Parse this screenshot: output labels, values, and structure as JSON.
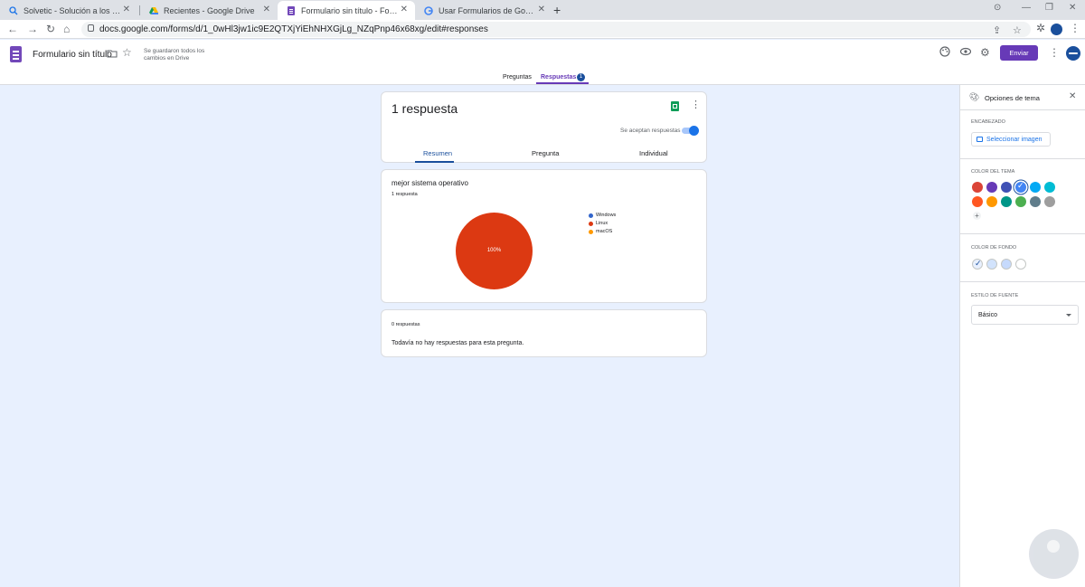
{
  "browser": {
    "tabs": [
      {
        "label": "Solvetic - Solución a los problemas",
        "icon": "search-icon"
      },
      {
        "label": "Recientes - Google Drive",
        "icon": "drive-icon"
      },
      {
        "label": "Formulario sin título - Formularios",
        "icon": "forms-icon"
      },
      {
        "label": "Usar Formularios de Google - Cr",
        "icon": "google-icon"
      }
    ],
    "url": "docs.google.com/forms/d/1_0wHl3jw1ic9E2QTXjYiEhNHXGjLg_NZqPnp46x68xg/edit#responses"
  },
  "app": {
    "form_title": "Formulario sin título",
    "saved_note": "Se guardaron todos los cambios en Drive",
    "send_label": "Enviar",
    "tabs": {
      "preguntas": "Preguntas",
      "respuestas": "Respuestas",
      "badge": "1"
    }
  },
  "summary": {
    "title": "1 respuesta",
    "accepting_label": "Se aceptan respuestas",
    "accepting": true,
    "subtabs": [
      "Resumen",
      "Pregunta",
      "Individual"
    ]
  },
  "question1": {
    "title": "mejor sistema operativo",
    "count": "1 respuesta",
    "pie_label": "100%"
  },
  "chart_data": {
    "type": "pie",
    "categories": [
      "Windows",
      "Linux",
      "macOS"
    ],
    "values": [
      0,
      100,
      0
    ],
    "colors": [
      "#3366cc",
      "#dc3912",
      "#ff9900"
    ]
  },
  "question2": {
    "count": "0 respuestas",
    "empty_text": "Todavía no hay respuestas para esta pregunta."
  },
  "theme_panel": {
    "title": "Opciones de tema",
    "header_label": "ENCABEZADO",
    "image_button": "Seleccionar imagen",
    "theme_color_label": "COLOR DEL TEMA",
    "theme_colors": [
      "#db4437",
      "#673ab7",
      "#3f51b5",
      "#4285f4",
      "#03a9f4",
      "#00bcd4",
      "#ff5722",
      "#ff9800",
      "#009688",
      "#4caf50",
      "#607d8b",
      "#9e9e9e"
    ],
    "theme_selected": 3,
    "bg_color_label": "COLOR DE FONDO",
    "bg_colors": [
      "#e8f0fe",
      "#d2e3fc",
      "#c6dafc",
      "#ffffff"
    ],
    "bg_selected": 0,
    "font_label": "ESTILO DE FUENTE",
    "font_value": "Básico"
  }
}
